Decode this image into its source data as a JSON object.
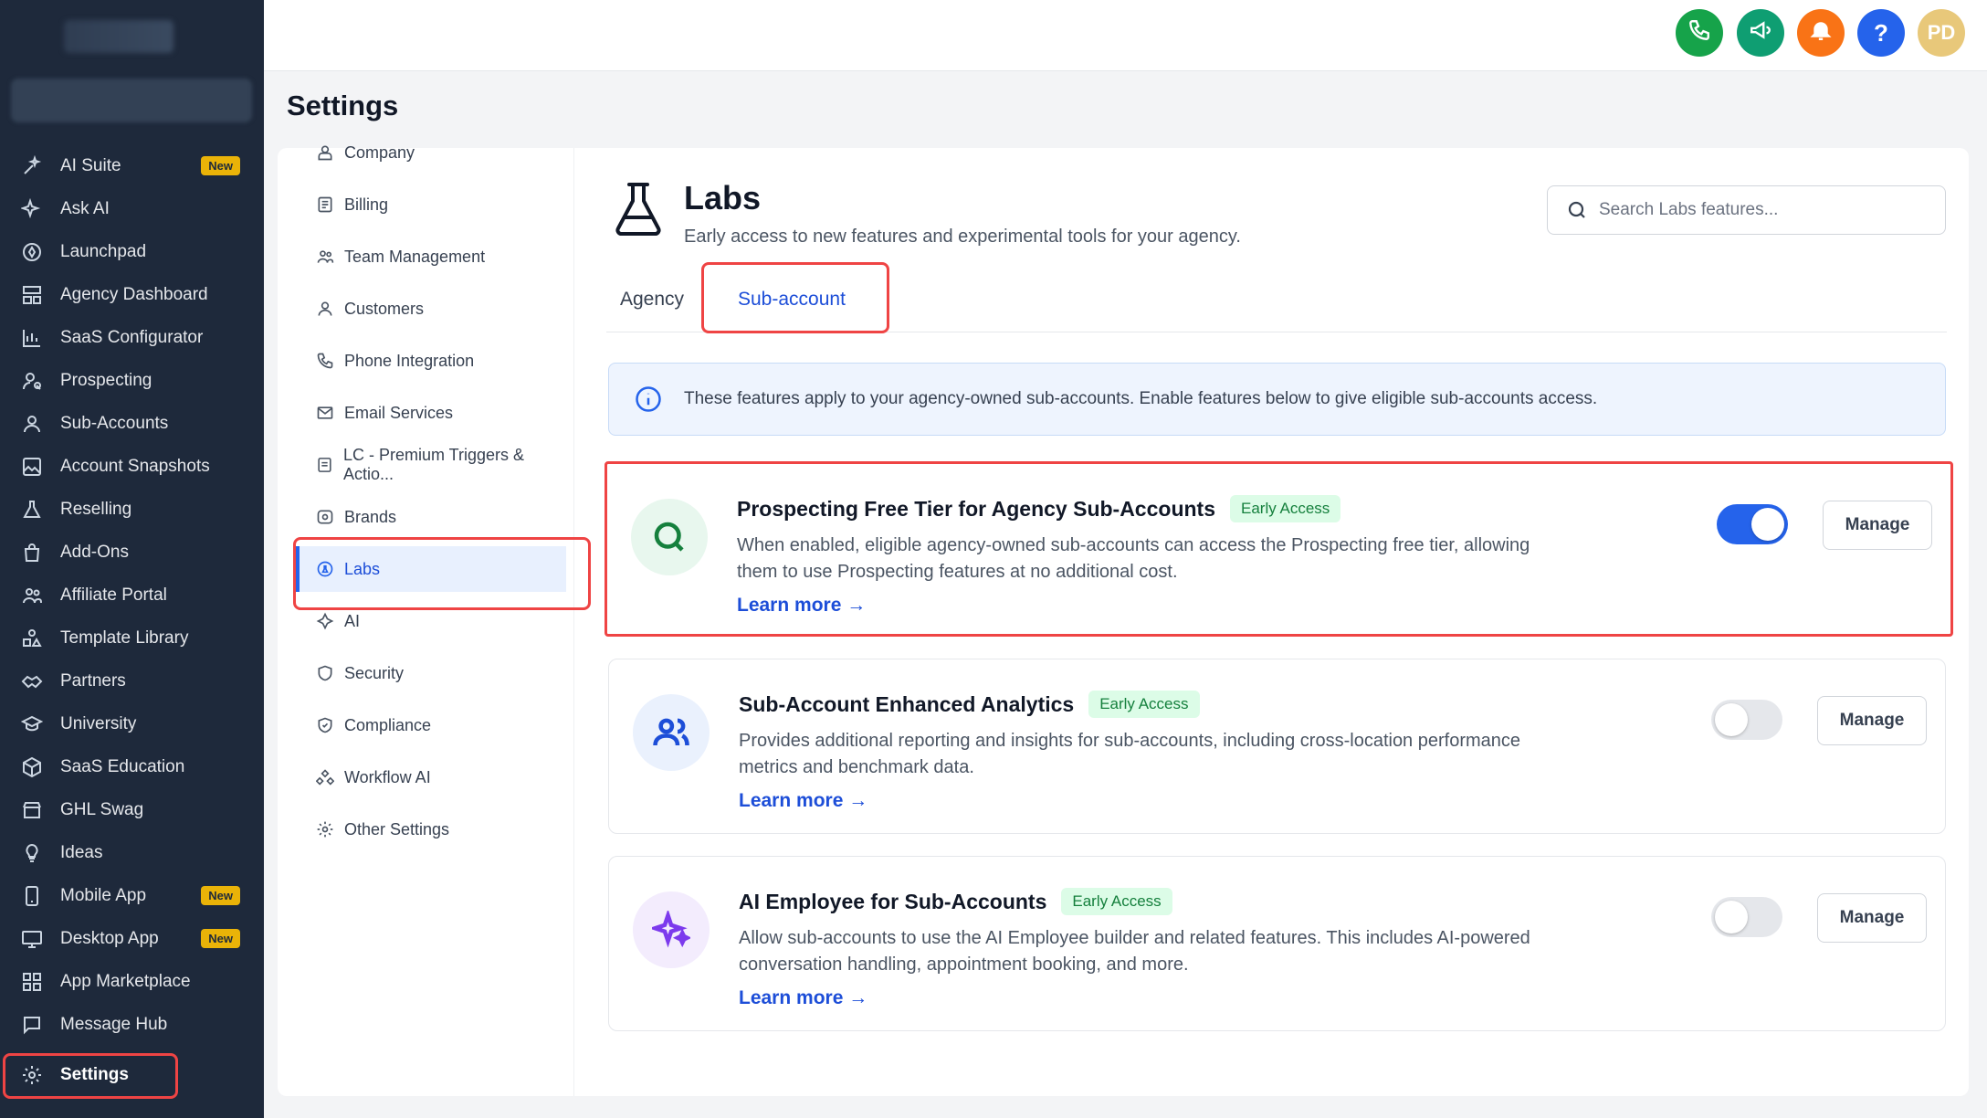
{
  "sidebar": {
    "items": [
      {
        "label": "AI Suite",
        "icon": "sparkle-pen-icon",
        "badge": "New"
      },
      {
        "label": "Ask AI",
        "icon": "sparkles-icon"
      },
      {
        "label": "Launchpad",
        "icon": "rocket-icon"
      },
      {
        "label": "Agency Dashboard",
        "icon": "dashboard-icon"
      },
      {
        "label": "SaaS Configurator",
        "icon": "bar-chart-icon"
      },
      {
        "label": "Prospecting",
        "icon": "user-search-icon"
      },
      {
        "label": "Sub-Accounts",
        "icon": "user-icon"
      },
      {
        "label": "Account Snapshots",
        "icon": "image-icon"
      },
      {
        "label": "Reselling",
        "icon": "flask-icon"
      },
      {
        "label": "Add-Ons",
        "icon": "bag-icon"
      },
      {
        "label": "Affiliate Portal",
        "icon": "users-icon"
      },
      {
        "label": "Template Library",
        "icon": "shapes-icon"
      },
      {
        "label": "Partners",
        "icon": "handshake-icon"
      },
      {
        "label": "University",
        "icon": "graduation-cap-icon"
      },
      {
        "label": "SaaS Education",
        "icon": "cube-icon"
      },
      {
        "label": "GHL Swag",
        "icon": "store-icon"
      },
      {
        "label": "Ideas",
        "icon": "lightbulb-icon"
      },
      {
        "label": "Mobile App",
        "icon": "phone-device-icon",
        "badge": "New"
      },
      {
        "label": "Desktop App",
        "icon": "monitor-icon",
        "badge": "New"
      },
      {
        "label": "App Marketplace",
        "icon": "grid-icon"
      },
      {
        "label": "Message Hub",
        "icon": "chat-icon"
      },
      {
        "label": "Settings",
        "icon": "gear-icon"
      }
    ]
  },
  "topbar": {
    "avatar_initials": "PD",
    "help_glyph": "?",
    "colors": {
      "phone": "#16a34a",
      "announce": "#0f9e72",
      "bell": "#f97316",
      "help": "#2563eb",
      "avatar": "#e8c87a"
    }
  },
  "page": {
    "title": "Settings"
  },
  "settings_nav": {
    "items": [
      {
        "label": "Company"
      },
      {
        "label": "Billing"
      },
      {
        "label": "Team Management"
      },
      {
        "label": "Customers"
      },
      {
        "label": "Phone Integration"
      },
      {
        "label": "Email Services"
      },
      {
        "label": "LC - Premium Triggers & Actio..."
      },
      {
        "label": "Brands"
      },
      {
        "label": "Labs"
      },
      {
        "label": "AI"
      },
      {
        "label": "Security"
      },
      {
        "label": "Compliance"
      },
      {
        "label": "Workflow AI"
      },
      {
        "label": "Other Settings"
      }
    ]
  },
  "labs": {
    "title": "Labs",
    "subtitle": "Early access to new features and experimental tools for your agency.",
    "search_placeholder": "Search Labs features...",
    "tabs": [
      {
        "label": "Agency"
      },
      {
        "label": "Sub-account"
      }
    ],
    "info": "These features apply to your agency-owned sub-accounts. Enable features below to give eligible sub-accounts access.",
    "features": [
      {
        "title": "Prospecting Free Tier for Agency Sub-Accounts",
        "badge": "Early Access",
        "description": "When enabled, eligible agency-owned sub-accounts can access the Prospecting free tier, allowing them to use Prospecting features at no additional cost.",
        "link": "Learn more →",
        "enabled": true,
        "manage": "Manage",
        "icon": "search-icon",
        "icon_color": "#15803d",
        "icon_bg": "#e8f7ee"
      },
      {
        "title": "Sub-Account Enhanced Analytics",
        "badge": "Early Access",
        "description": "Provides additional reporting and insights for sub-accounts, including cross-location performance metrics and benchmark data.",
        "link": "Learn more →",
        "enabled": false,
        "manage": "Manage",
        "icon": "users-icon",
        "icon_color": "#1d4ed8",
        "icon_bg": "#eaf1fd"
      },
      {
        "title": "AI Employee for Sub-Accounts",
        "badge": "Early Access",
        "description": "Allow sub-accounts to use the AI Employee builder and related features. This includes AI-powered conversation handling, appointment booking, and more.",
        "link": "Learn more →",
        "enabled": false,
        "manage": "Manage",
        "icon": "sparkles-icon",
        "icon_color": "#7c3aed",
        "icon_bg": "#f3ecfd"
      }
    ]
  }
}
